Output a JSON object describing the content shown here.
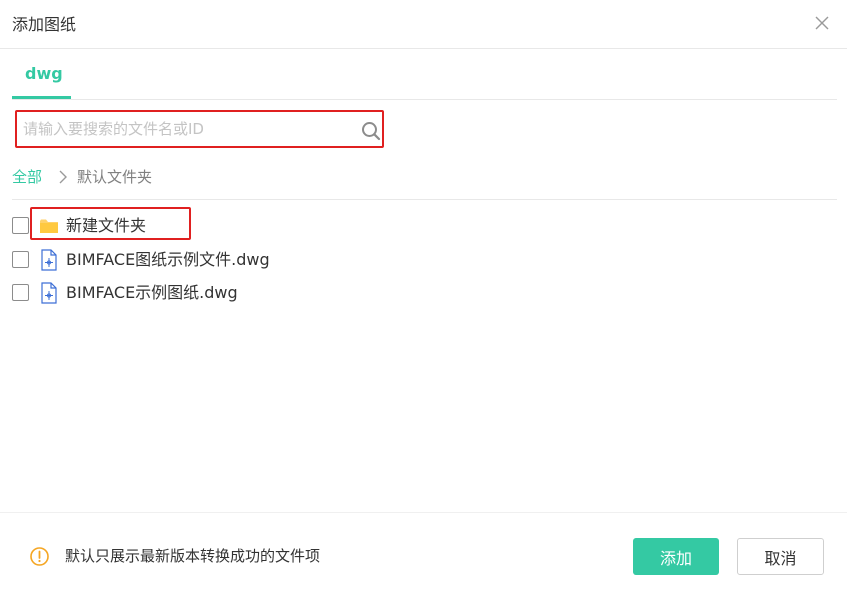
{
  "dialog": {
    "title": "添加图纸"
  },
  "tabs": [
    {
      "label": "dwg",
      "active": true
    }
  ],
  "search": {
    "placeholder": "请输入要搜索的文件名或ID",
    "value": ""
  },
  "breadcrumb": {
    "root": "全部",
    "current": "默认文件夹"
  },
  "files": [
    {
      "name": "新建文件夹",
      "type": "folder",
      "icon": "folder-icon",
      "checked": false
    },
    {
      "name": "BIMFACE图纸示例文件.dwg",
      "type": "dwg",
      "icon": "dwg-file-icon",
      "checked": false
    },
    {
      "name": "BIMFACE示例图纸.dwg",
      "type": "dwg",
      "icon": "dwg-file-icon",
      "checked": false
    }
  ],
  "footer": {
    "info_icon": "info-circle-icon",
    "info_text": "默认只展示最新版本转换成功的文件项",
    "add_label": "添加",
    "cancel_label": "取消"
  },
  "colors": {
    "accent": "#34c9a3",
    "highlight": "#e02020",
    "info": "#f5a623",
    "file_icon": "#3d6fd6",
    "folder": "#ffd26b"
  }
}
